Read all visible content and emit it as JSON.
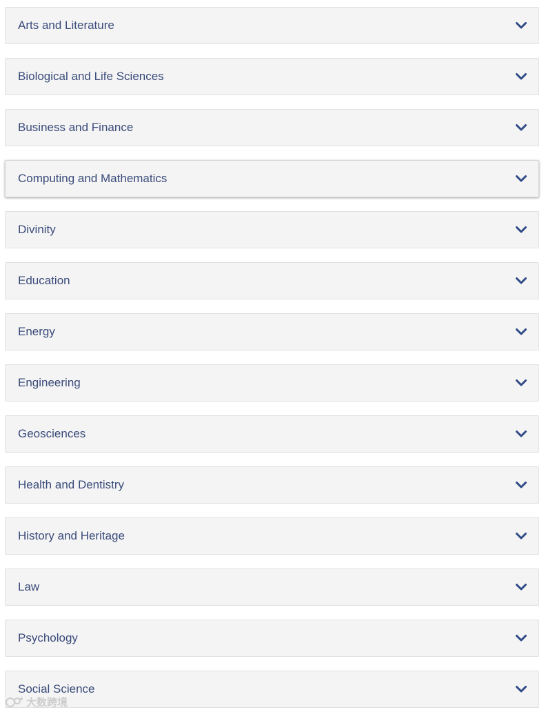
{
  "accordion": {
    "items": [
      {
        "label": "Arts and Literature"
      },
      {
        "label": "Biological and Life Sciences"
      },
      {
        "label": "Business and Finance"
      },
      {
        "label": "Computing and Mathematics",
        "hovered": true
      },
      {
        "label": "Divinity"
      },
      {
        "label": "Education"
      },
      {
        "label": "Energy"
      },
      {
        "label": "Engineering"
      },
      {
        "label": "Geosciences"
      },
      {
        "label": "Health and Dentistry"
      },
      {
        "label": "History and Heritage"
      },
      {
        "label": "Law"
      },
      {
        "label": "Psychology"
      },
      {
        "label": "Social Science"
      }
    ],
    "expand_icon": "chevron-down-icon"
  },
  "watermark": {
    "text": "大数跨境"
  },
  "colors": {
    "item_background": "#f4f4f4",
    "item_border": "#e0e0e0",
    "label_text": "#3a4b7a",
    "chevron": "#2f4a86"
  }
}
